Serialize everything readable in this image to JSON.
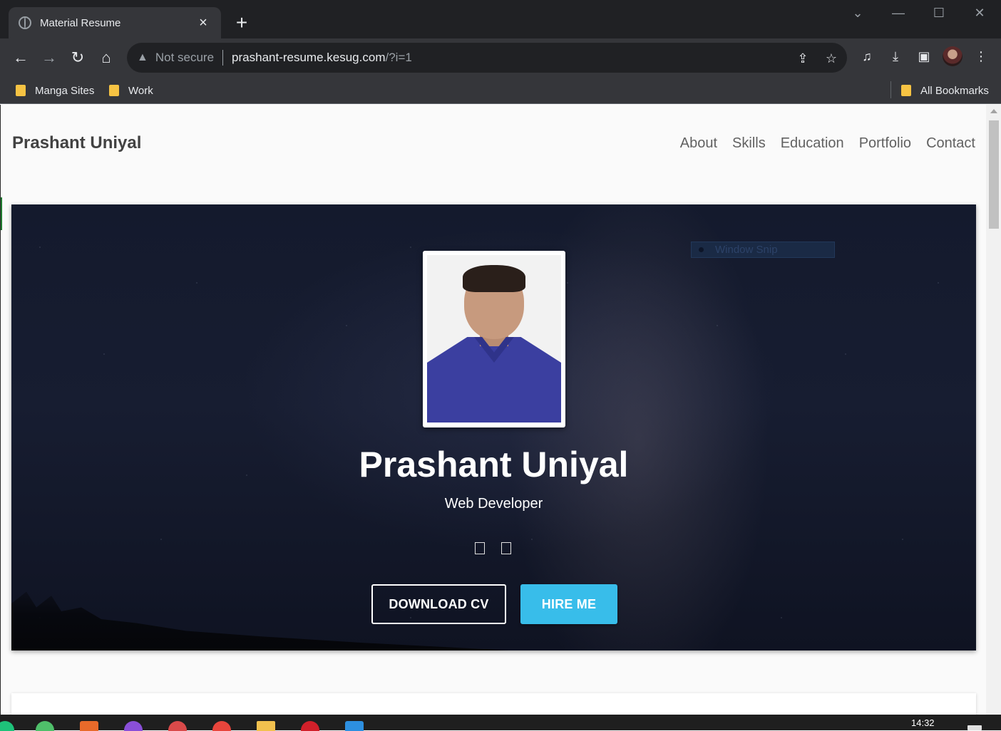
{
  "browser": {
    "tab_title": "Material Resume",
    "security_label": "Not secure",
    "url_host": "prashant-resume.kesug.com",
    "url_path": "/?i=1",
    "bookmarks": [
      "Manga Sites",
      "Work"
    ],
    "all_bookmarks_label": "All Bookmarks"
  },
  "site": {
    "brand": "Prashant Uniyal",
    "nav": [
      "About",
      "Skills",
      "Education",
      "Portfolio",
      "Contact"
    ]
  },
  "hero": {
    "name": "Prashant Uniyal",
    "role": "Web Developer",
    "download_label": "DOWNLOAD CV",
    "hire_label": "HIRE ME",
    "overlay_chip": "Window Snip"
  },
  "taskbar": {
    "time": "14:32"
  },
  "colors": {
    "accent": "#38bdea",
    "hero_bg": "#171d31",
    "chrome_dark": "#202124"
  },
  "icons": [
    "globe-icon",
    "close-icon",
    "plus-icon",
    "back-icon",
    "forward-icon",
    "reload-icon",
    "home-icon",
    "warning-icon",
    "share-icon",
    "star-icon",
    "media-icon",
    "download-icon",
    "sidepanel-icon",
    "menu-icon",
    "folder-icon"
  ]
}
